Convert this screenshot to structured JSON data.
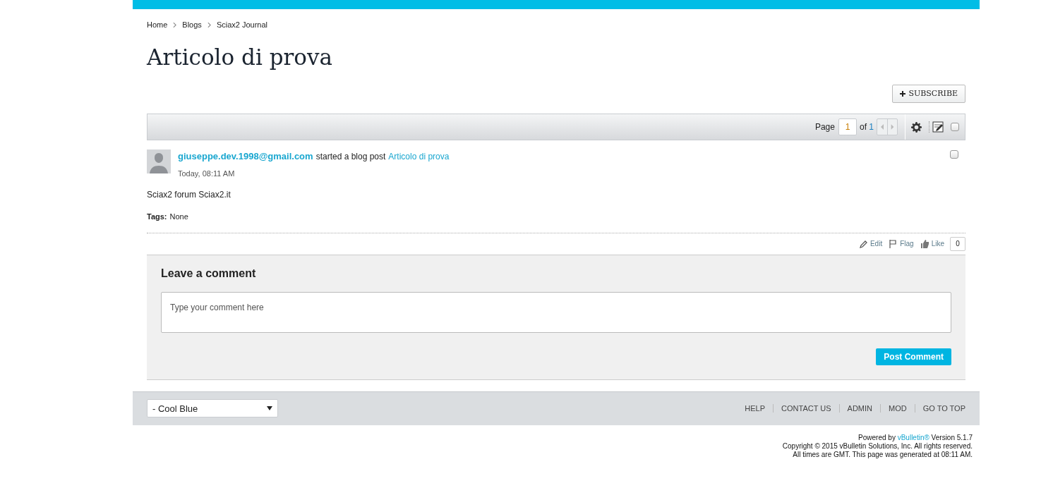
{
  "breadcrumbs": [
    "Home",
    "Blogs",
    "Sciax2 Journal"
  ],
  "title": "Articolo di prova",
  "subscribe_button": "SUBSCRIBE",
  "pagination": {
    "label": "Page",
    "value": "1",
    "of": "of",
    "total": "1"
  },
  "select_all": {
    "checked": false
  },
  "post": {
    "author": "giuseppe.dev.1998@gmail.com",
    "action": "started a blog post",
    "link": "Articolo di prova",
    "time": "Today, 08:11 AM",
    "checked": false,
    "body": "Sciax2 forum Sciax2.it",
    "tags_label": "Tags:",
    "tags": "None",
    "actions": [
      {
        "kind": "edit",
        "label": "Edit"
      },
      {
        "kind": "flag",
        "label": "Flag"
      },
      {
        "kind": "like",
        "label": "Like"
      }
    ],
    "like_count": "0"
  },
  "comment": {
    "heading": "Leave a comment",
    "placeholder": "Type your comment here",
    "button": "Post Comment"
  },
  "footer": {
    "style_select": "- Cool Blue",
    "links": [
      "HELP",
      "CONTACT US",
      "ADMIN",
      "MOD",
      "GO TO TOP"
    ]
  },
  "credits": {
    "powered_prefix": "Powered by",
    "powered_link": "vBulletin®",
    "powered_suffix": "Version 5.1.7",
    "lines": [
      "Copyright © 2015 vBulletin Solutions, Inc. All rights reserved.",
      "All times are GMT. This page was generated at 08:11 AM."
    ]
  }
}
